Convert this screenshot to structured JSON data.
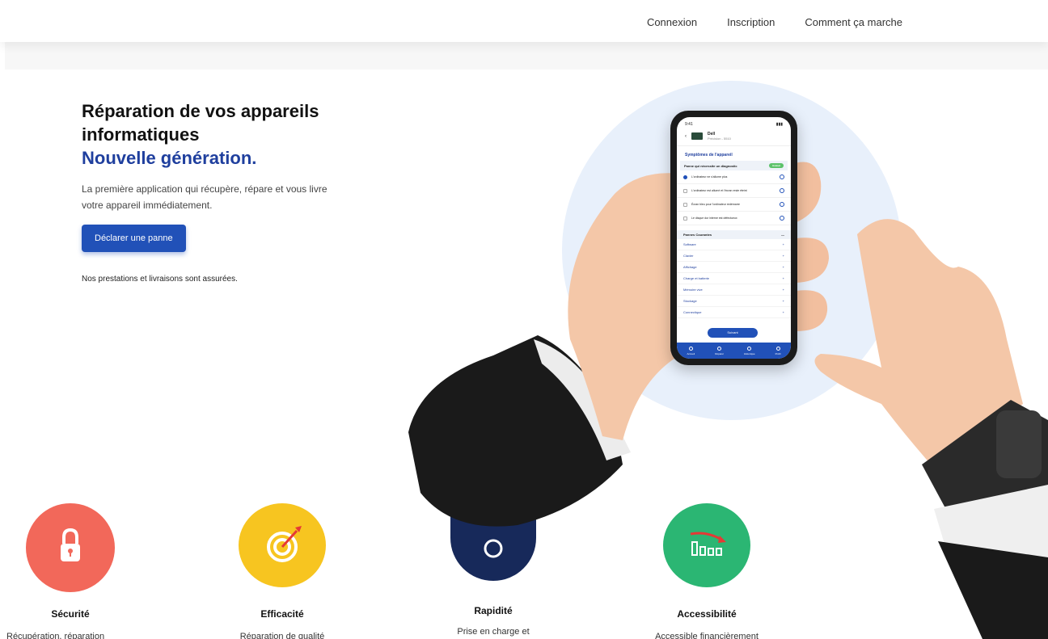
{
  "nav": {
    "links": [
      "Connexion",
      "Inscription",
      "Comment ça marche"
    ]
  },
  "hero": {
    "title_line1": "Réparation de vos appareils",
    "title_line2": "informatiques",
    "title_accent": "Nouvelle génération.",
    "description": "La première application qui récupère, répare et vous livre votre appareil immédiatement.",
    "cta_label": "Déclarer une panne",
    "note": "Nos prestations et livraisons sont assurées."
  },
  "phone": {
    "time": "9:41",
    "device_name": "Dell",
    "device_sub": "Précision - 5510",
    "section_title": "Symptômes de l'appareil",
    "diag_label": "Panne qui nécessite un diagnostic",
    "diag_pill": "Gratuit",
    "symptoms": [
      {
        "text": "L'ordinateur ne s'allume plus",
        "checked": true
      },
      {
        "text": "L'ordinateur est allumé et l'écran reste éteint",
        "checked": false
      },
      {
        "text": "Écran bleu pour l'ordinateur redémarre",
        "checked": false
      },
      {
        "text": "Le disque dur interne est défectueux",
        "checked": false
      }
    ],
    "common_title": "Pannes Courantes",
    "common_items": [
      "Software",
      "Clavier",
      "Affichage",
      "Charge et batterie",
      "Mémoire vive",
      "Stockage",
      "Connectique"
    ],
    "next_label": "Suivant",
    "tabs": [
      "Accueil",
      "Réparer",
      "Historique",
      "Profil"
    ]
  },
  "features": [
    {
      "title": "Sécurité",
      "text": "Récupération, réparation",
      "color": "#f2685a",
      "icon": "lock-icon"
    },
    {
      "title": "Efficacité",
      "text": "Réparation de qualité",
      "color": "#f7c520",
      "icon": "target-icon"
    },
    {
      "title": "Rapidité",
      "text": "Prise en charge et",
      "color": "#17295a",
      "icon": "clock-icon"
    },
    {
      "title": "Accessibilité",
      "text": "Accessible financièrement",
      "color": "#2bb673",
      "icon": "price-drop-icon"
    }
  ],
  "colors": {
    "accent": "#1f3f9e",
    "cta": "#2151b8",
    "bg_circle": "#e8f0fb"
  }
}
